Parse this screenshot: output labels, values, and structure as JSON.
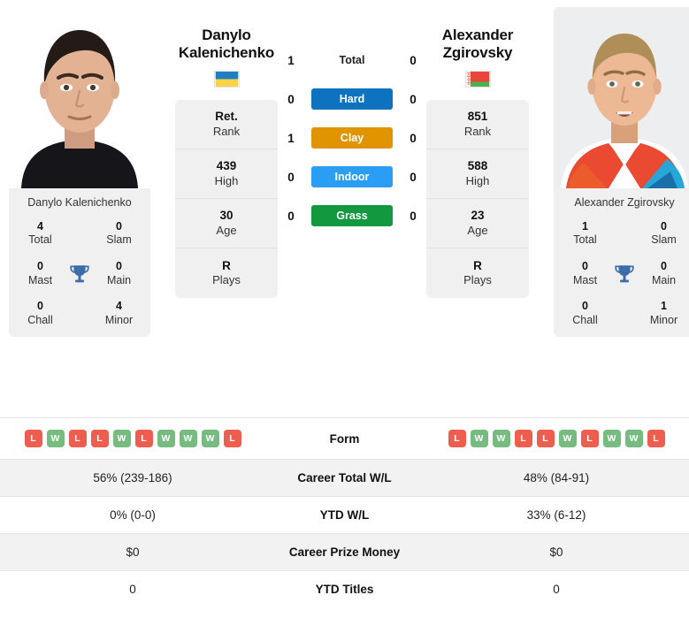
{
  "players": {
    "left": {
      "first_name": "Danylo",
      "last_name": "Kalenichenko",
      "full_name": "Danylo Kalenichenko",
      "country": "Ukraine",
      "flag": "ukraine-flag",
      "stats": [
        {
          "value": "Ret.",
          "label": "Rank"
        },
        {
          "value": "439",
          "label": "High"
        },
        {
          "value": "30",
          "label": "Age"
        },
        {
          "value": "R",
          "label": "Plays"
        }
      ],
      "titles": {
        "total": "4",
        "slam": "0",
        "mast": "0",
        "main": "0",
        "chall": "0",
        "minor": "4"
      },
      "h2h": {
        "total": "1",
        "hard": "0",
        "clay": "1",
        "indoor": "0",
        "grass": "0"
      },
      "form": [
        "L",
        "W",
        "L",
        "L",
        "W",
        "L",
        "W",
        "W",
        "W",
        "L"
      ],
      "career_total_wl": "56% (239-186)",
      "ytd_wl": "0% (0-0)",
      "career_prize_money": "$0",
      "ytd_titles": "0"
    },
    "right": {
      "first_name": "Alexander",
      "last_name": "Zgirovsky",
      "full_name": "Alexander Zgirovsky",
      "country": "Belarus",
      "flag": "belarus-flag",
      "stats": [
        {
          "value": "851",
          "label": "Rank"
        },
        {
          "value": "588",
          "label": "High"
        },
        {
          "value": "23",
          "label": "Age"
        },
        {
          "value": "R",
          "label": "Plays"
        }
      ],
      "titles": {
        "total": "1",
        "slam": "0",
        "mast": "0",
        "main": "0",
        "chall": "0",
        "minor": "1"
      },
      "h2h": {
        "total": "0",
        "hard": "0",
        "clay": "0",
        "indoor": "0",
        "grass": "0"
      },
      "form": [
        "L",
        "W",
        "W",
        "L",
        "L",
        "W",
        "L",
        "W",
        "W",
        "L"
      ],
      "career_total_wl": "48% (84-91)",
      "ytd_wl": "33% (6-12)",
      "career_prize_money": "$0",
      "ytd_titles": "0"
    }
  },
  "titles_labels": {
    "total": "Total",
    "slam": "Slam",
    "mast": "Mast",
    "main": "Main",
    "chall": "Chall",
    "minor": "Minor",
    "trophy_icon": "trophy-icon"
  },
  "surfaces": [
    {
      "key": "total",
      "label": "Total",
      "color": "transparent"
    },
    {
      "key": "hard",
      "label": "Hard",
      "color": "#0d72bf"
    },
    {
      "key": "clay",
      "label": "Clay",
      "color": "#e09400"
    },
    {
      "key": "indoor",
      "label": "Indoor",
      "color": "#2a9df4"
    },
    {
      "key": "grass",
      "label": "Grass",
      "color": "#12983f"
    }
  ],
  "table_rows": [
    {
      "label": "Form",
      "key": "form"
    },
    {
      "label": "Career Total W/L",
      "key": "career_total_wl"
    },
    {
      "label": "YTD W/L",
      "key": "ytd_wl"
    },
    {
      "label": "Career Prize Money",
      "key": "career_prize_money"
    },
    {
      "label": "YTD Titles",
      "key": "ytd_titles"
    }
  ],
  "colors": {
    "win": "#76bb7f",
    "loss": "#ed5e4f",
    "hard": "#0d72bf",
    "clay": "#e09400",
    "indoor": "#2a9df4",
    "grass": "#12983f",
    "trophy": "#3d6da8",
    "card_bg": "#f0f0f0",
    "row_alt_bg": "#f2f2f2"
  }
}
